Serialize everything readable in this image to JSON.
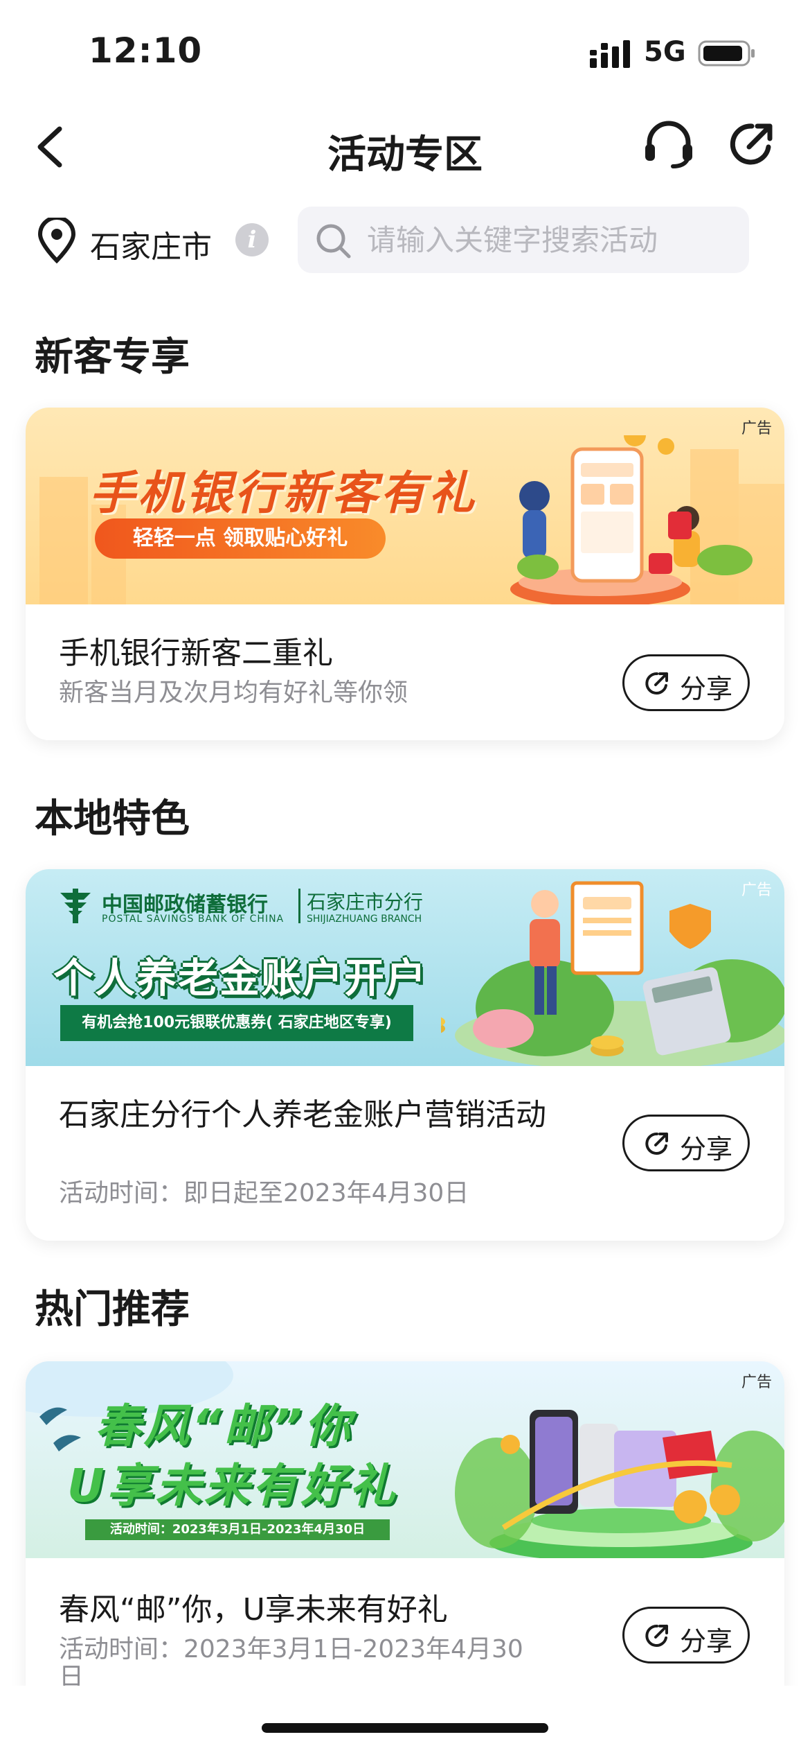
{
  "status_bar": {
    "time": "12:10",
    "network": "5G"
  },
  "nav": {
    "title": "活动专区"
  },
  "location": {
    "city": "石家庄市"
  },
  "search": {
    "placeholder": "请输入关键字搜索活动"
  },
  "sections": [
    {
      "title": "新客专享",
      "card": {
        "ad_label": "广告",
        "banner_title": "手机银行新客有礼",
        "banner_pill": "轻轻一点 领取贴心好礼",
        "title": "手机银行新客二重礼",
        "subtitle": "新客当月及次月均有好礼等你领",
        "share_label": "分享"
      }
    },
    {
      "title": "本地特色",
      "card": {
        "ad_label": "广告",
        "bank_name": "中国邮政储蓄银行",
        "bank_name_en": "POSTAL SAVINGS BANK OF CHINA",
        "branch_name": "石家庄市分行",
        "branch_name_en": "SHIJIAZHUANG BRANCH",
        "banner_title": "个人养老金账户开户",
        "banner_strip": "有机会抢100元银联优惠券( 石家庄地区专享)",
        "title": "石家庄分行个人养老金账户营销活动",
        "subtitle": "活动时间：即日起至2023年4月30日",
        "share_label": "分享"
      }
    },
    {
      "title": "热门推荐",
      "card": {
        "ad_label": "广告",
        "banner_line1": "春风“邮”你",
        "banner_line2": "U享未来有好礼",
        "banner_strip": "活动时间：2023年3月1日-2023年4月30日",
        "title": "春风“邮”你，U享未来有好礼",
        "subtitle": "活动时间：2023年3月1日-2023年4月30日",
        "share_label": "分享"
      }
    }
  ],
  "colors": {
    "brand_green": "#0e6d3a",
    "accent_orange": "#e8531a",
    "placeholder": "#b8b8be"
  }
}
